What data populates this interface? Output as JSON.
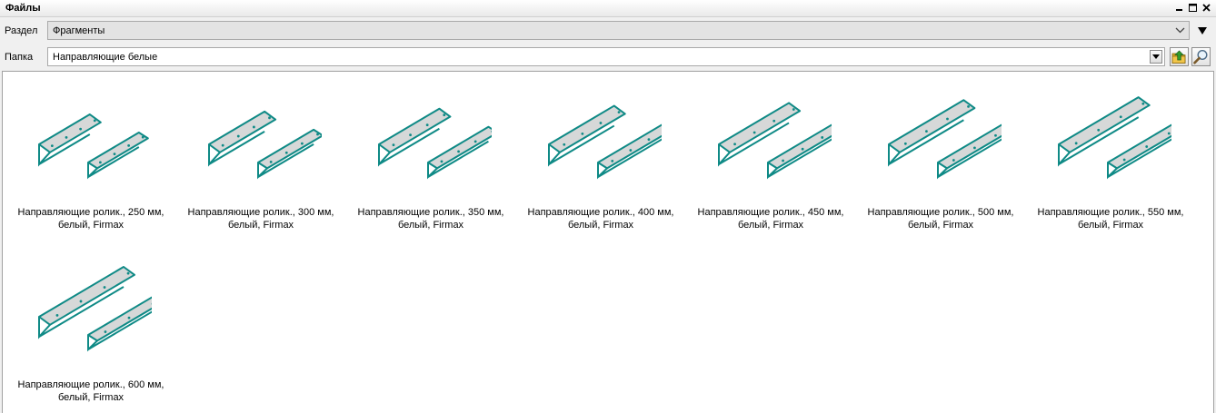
{
  "window": {
    "title": "Файлы",
    "buttons": [
      "minimize",
      "maximize",
      "close"
    ]
  },
  "section": {
    "label": "Раздел",
    "value": "Фрагменты"
  },
  "folder": {
    "label": "Папка",
    "value": "Направляющие белые"
  },
  "toolbar": {
    "up_icon": "folder-up-icon",
    "search_icon": "magnifier-icon"
  },
  "colors": {
    "accent": "#0f8a86",
    "rail_fill": "#d6d8d8"
  },
  "files": [
    {
      "line1": "Направляющие ролик., 250 мм,",
      "line2": "белый, Firmax"
    },
    {
      "line1": "Направляющие ролик., 300 мм,",
      "line2": "белый, Firmax"
    },
    {
      "line1": "Направляющие ролик., 350 мм,",
      "line2": "белый, Firmax"
    },
    {
      "line1": "Направляющие ролик., 400 мм,",
      "line2": "белый, Firmax"
    },
    {
      "line1": "Направляющие ролик., 450 мм,",
      "line2": "белый, Firmax"
    },
    {
      "line1": "Направляющие ролик., 500 мм,",
      "line2": "белый, Firmax"
    },
    {
      "line1": "Направляющие ролик., 550 мм,",
      "line2": "белый, Firmax"
    },
    {
      "line1": "Направляющие ролик., 600 мм,",
      "line2": "белый, Firmax"
    }
  ]
}
